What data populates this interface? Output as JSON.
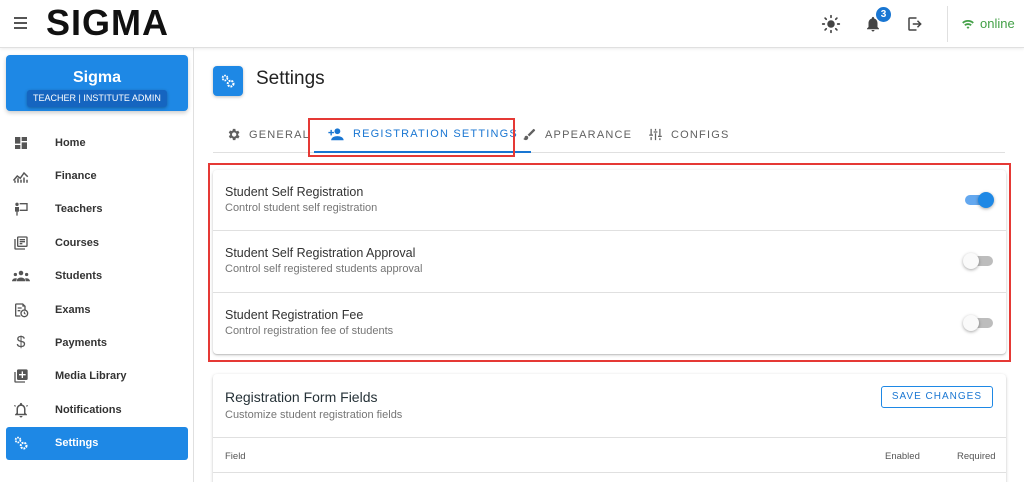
{
  "app": {
    "logo": "SIGMA"
  },
  "topbar": {
    "notifications_count": "3",
    "status": "online"
  },
  "sidebar": {
    "brand_name": "Sigma",
    "brand_role": "TEACHER | INSTITUTE ADMIN",
    "items": [
      {
        "label": "Home",
        "icon": "dashboard-icon"
      },
      {
        "label": "Finance",
        "icon": "finance-chart-icon"
      },
      {
        "label": "Teachers",
        "icon": "teacher-icon"
      },
      {
        "label": "Courses",
        "icon": "courses-icon"
      },
      {
        "label": "Students",
        "icon": "students-icon"
      },
      {
        "label": "Exams",
        "icon": "exams-icon"
      },
      {
        "label": "Payments",
        "icon": "dollar-icon"
      },
      {
        "label": "Media Library",
        "icon": "media-library-icon"
      },
      {
        "label": "Notifications",
        "icon": "bell-icon"
      },
      {
        "label": "Settings",
        "icon": "cogs-icon"
      }
    ],
    "active_item": "Settings"
  },
  "page": {
    "title": "Settings",
    "tabs": [
      {
        "label": "GENERAL",
        "icon": "cog-icon"
      },
      {
        "label": "REGISTRATION SETTINGS",
        "icon": "add-user-icon"
      },
      {
        "label": "APPEARANCE",
        "icon": "brush-icon"
      },
      {
        "label": "CONFIGS",
        "icon": "tune-icon"
      }
    ],
    "active_tab": "REGISTRATION SETTINGS"
  },
  "registration_settings": [
    {
      "title": "Student Self Registration",
      "subtitle": "Control student self registration",
      "enabled": true
    },
    {
      "title": "Student Self Registration Approval",
      "subtitle": "Control self registered students approval",
      "enabled": false
    },
    {
      "title": "Student Registration Fee",
      "subtitle": "Control registration fee of students",
      "enabled": false
    }
  ],
  "form_fields": {
    "title": "Registration Form Fields",
    "subtitle": "Customize student registration fields",
    "save_label": "SAVE CHANGES",
    "columns": {
      "field": "Field",
      "enabled": "Enabled",
      "required": "Required"
    }
  },
  "colors": {
    "primary": "#1e88e5",
    "online": "#43a047",
    "highlight": "#e53935"
  }
}
